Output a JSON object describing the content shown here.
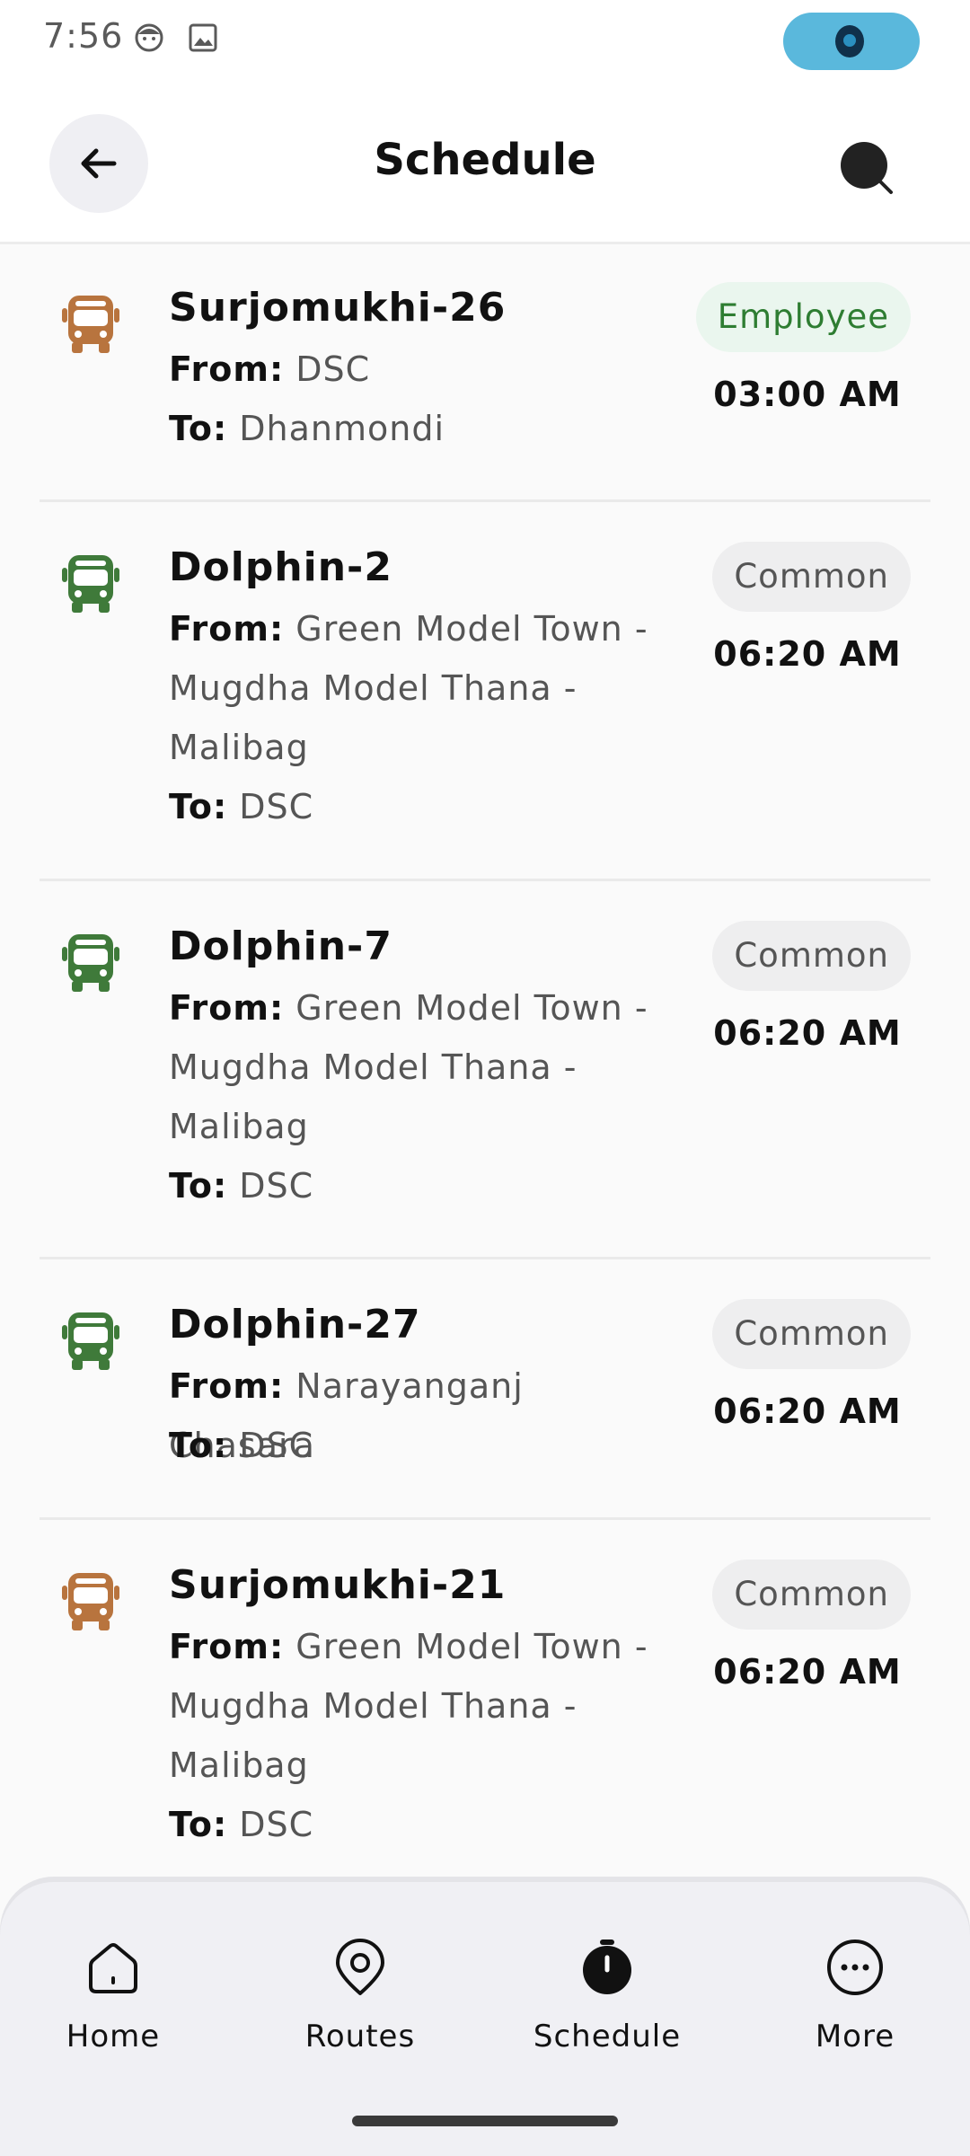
{
  "status_bar": {
    "time": "7:56"
  },
  "app_bar": {
    "title": "Schedule"
  },
  "schedules": [
    {
      "name": "Surjomukhi-26",
      "from_label": "From:",
      "from": "DSC",
      "to_label": "To:",
      "to": "Dhanmondi",
      "badge": "Employee",
      "time": "03:00 AM",
      "bus_color": "#b8743e"
    },
    {
      "name": "Dolphin-2",
      "from_label": "From:",
      "from": "Green Model Town - Mugdha Model Thana - Malibag",
      "to_label": "To:",
      "to": "DSC",
      "badge": "Common",
      "time": "06:20 AM",
      "bus_color": "#3f7a3a"
    },
    {
      "name": "Dolphin-7",
      "from_label": "From:",
      "from": "Green Model Town - Mugdha Model Thana - Malibag",
      "to_label": "To:",
      "to": "DSC",
      "badge": "Common",
      "time": "06:20 AM",
      "bus_color": "#3f7a3a"
    },
    {
      "name": "Dolphin-27",
      "from_label": "From:",
      "from": "Narayanganj Chasara",
      "to_label": "To:",
      "to": "DSC",
      "badge": "Common",
      "time": "06:20 AM",
      "bus_color": "#3f7a3a"
    },
    {
      "name": "Surjomukhi-21",
      "from_label": "From:",
      "from": "Green Model Town - Mugdha Model Thana - Malibag",
      "to_label": "To:",
      "to": "DSC",
      "badge": "Common",
      "time": "06:20 AM",
      "bus_color": "#b8743e"
    }
  ],
  "bottom_nav": {
    "items": [
      {
        "label": "Home",
        "icon": "home-icon"
      },
      {
        "label": "Routes",
        "icon": "location-pin-icon"
      },
      {
        "label": "Schedule",
        "icon": "stopwatch-icon",
        "active": true
      },
      {
        "label": "More",
        "icon": "more-dots-icon"
      }
    ]
  },
  "colors": {
    "employee_badge_bg": "#eaf6ee",
    "employee_badge_text": "#2e7d32",
    "common_badge_bg": "#eeeeef",
    "status_pill": "#5ab8dc"
  }
}
